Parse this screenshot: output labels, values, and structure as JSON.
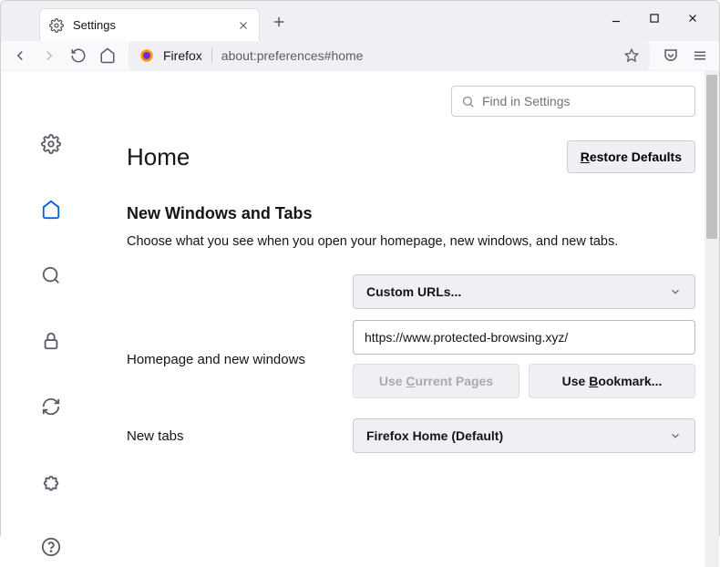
{
  "tab": {
    "title": "Settings"
  },
  "urlbar": {
    "brand": "Firefox",
    "url": "about:preferences#home"
  },
  "search": {
    "placeholder": "Find in Settings"
  },
  "page": {
    "title": "Home",
    "restore": "Restore Defaults",
    "section_heading": "New Windows and Tabs",
    "section_desc": "Choose what you see when you open your homepage, new windows, and new tabs."
  },
  "homepage": {
    "label": "Homepage and new windows",
    "dropdown_value": "Custom URLs...",
    "url_value": "https://www.protected-browsing.xyz/",
    "use_current": "Use Current Pages",
    "use_bookmark": "Use Bookmark..."
  },
  "newtabs": {
    "label": "New tabs",
    "dropdown_value": "Firefox Home (Default)"
  }
}
